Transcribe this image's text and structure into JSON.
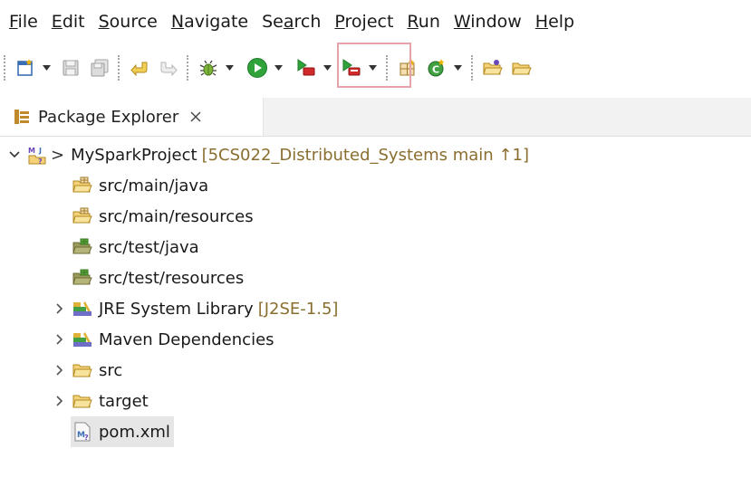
{
  "menu": [
    {
      "mnemonic": "F",
      "rest": "ile"
    },
    {
      "mnemonic": "E",
      "rest": "dit"
    },
    {
      "mnemonic": "S",
      "rest": "ource"
    },
    {
      "mnemonic": "N",
      "rest": "avigate"
    },
    {
      "mnemonic": "",
      "pre": "Se",
      "mn": "a",
      "rest": "rch"
    },
    {
      "mnemonic": "P",
      "rest": "roject"
    },
    {
      "mnemonic": "R",
      "rest": "un"
    },
    {
      "mnemonic": "W",
      "rest": "indow"
    },
    {
      "mnemonic": "H",
      "rest": "elp"
    }
  ],
  "view_tab": {
    "title": "Package Explorer"
  },
  "tree": {
    "project": {
      "name": "MySparkProject",
      "decoration": "[5CS022_Distributed_Systems main ↑1]",
      "prefix": ">"
    },
    "source_folders": [
      "src/main/java",
      "src/main/resources",
      "src/test/java",
      "src/test/resources"
    ],
    "jre": {
      "name": "JRE System Library",
      "decoration": "[J2SE-1.5]"
    },
    "maven": {
      "name": "Maven Dependencies"
    },
    "folders": [
      "src",
      "target"
    ],
    "file": {
      "name": "pom.xml"
    }
  },
  "colors": {
    "run_green": "#2fa33a",
    "highlight_border": "#e5a2ab",
    "decoration_text": "#8a6e2f",
    "selected_row": "#e6e6e6"
  }
}
